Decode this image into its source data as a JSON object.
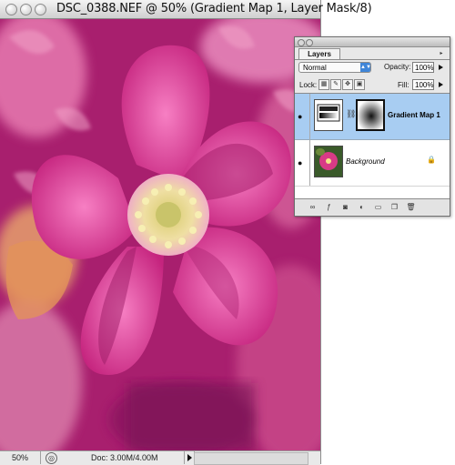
{
  "document": {
    "title": "DSC_0388.NEF @ 50% (Gradient Map 1, Layer Mask/8)",
    "zoom": "50%",
    "doc_size": "Doc: 3.00M/4.00M"
  },
  "layers_panel": {
    "tab_label": "Layers",
    "blend_mode": "Normal",
    "opacity_label": "Opacity:",
    "opacity_value": "100%",
    "lock_label": "Lock:",
    "fill_label": "Fill:",
    "fill_value": "100%",
    "layers": [
      {
        "name": "Gradient Map 1",
        "selected": true,
        "visible": true
      },
      {
        "name": "Background",
        "selected": false,
        "visible": true,
        "locked": true
      }
    ],
    "footer_icons": [
      "link-layers-icon",
      "layer-style-icon",
      "add-mask-icon",
      "adjustment-layer-icon",
      "new-group-icon",
      "new-layer-icon",
      "trash-icon"
    ]
  },
  "colors": {
    "photo_background": "#a8206e",
    "selected_layer": "#a8cdf2",
    "select_accent": "#3f85d8"
  }
}
